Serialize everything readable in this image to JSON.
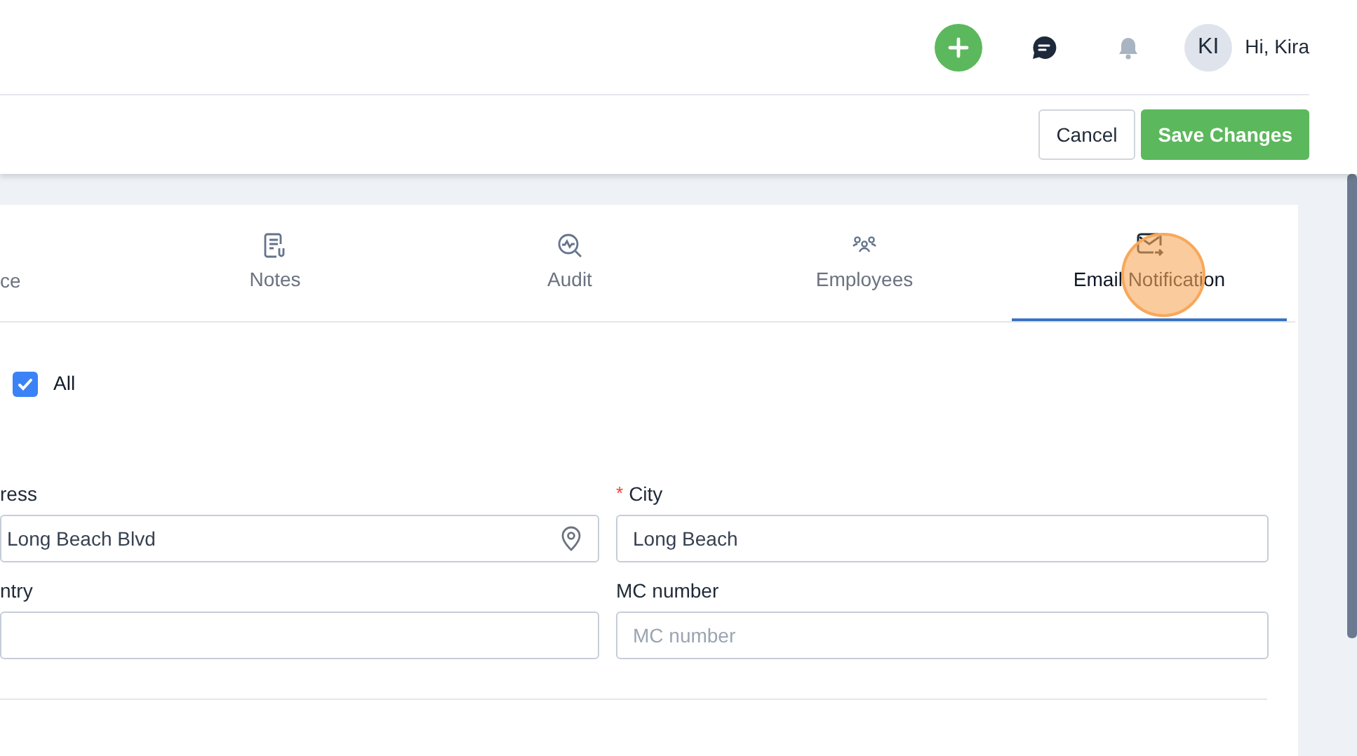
{
  "header": {
    "avatar_initials": "KI",
    "greeting": "Hi, Kira"
  },
  "actions": [
    {
      "label": "Cancel",
      "kind": "secondary"
    },
    {
      "label": "Save Changes",
      "kind": "primary"
    }
  ],
  "tabs": [
    {
      "label": "ce",
      "selected": false
    },
    {
      "label": "Notes",
      "selected": false
    },
    {
      "label": "Audit",
      "selected": false
    },
    {
      "label": "Employees",
      "selected": false
    },
    {
      "label": "Email Notification",
      "selected": true
    }
  ],
  "click_indicator": true,
  "select_all": {
    "label": "All",
    "checked": true
  },
  "fields": [
    {
      "label": "ress",
      "value": "Long Beach Blvd"
    },
    {
      "label": "City",
      "required_mark": "*",
      "value": "Long Beach"
    },
    {
      "label": "ntry"
    },
    {
      "label": "MC number",
      "placeholder": "MC number"
    }
  ]
}
